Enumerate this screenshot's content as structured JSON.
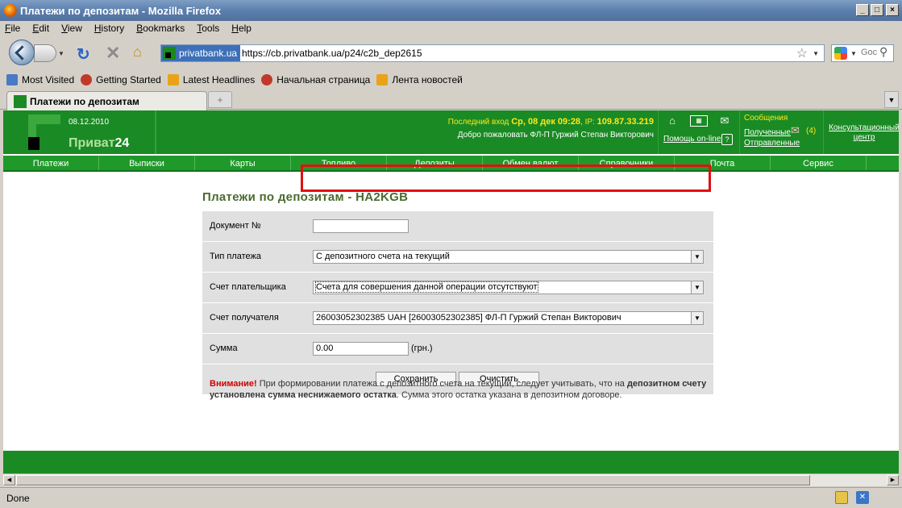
{
  "window": {
    "title": "Платежи по депозитам - Mozilla Firefox"
  },
  "menu": [
    "File",
    "Edit",
    "View",
    "History",
    "Bookmarks",
    "Tools",
    "Help"
  ],
  "address": {
    "site_label": "privatbank.ua",
    "url": "https://cb.privatbank.ua/p24/c2b_dep2615",
    "search_text": "Goc"
  },
  "bookmarks": [
    {
      "label": "Most Visited",
      "icon": "most-visited-icon",
      "color": "#4a7ac4"
    },
    {
      "label": "Getting Started",
      "icon": "firefox-icon",
      "color": "#c0392b"
    },
    {
      "label": "Latest Headlines",
      "icon": "rss-icon",
      "color": "#e8a317"
    },
    {
      "label": "Начальная страница",
      "icon": "firefox-icon",
      "color": "#c0392b"
    },
    {
      "label": "Лента новостей",
      "icon": "rss-icon",
      "color": "#e8a317"
    }
  ],
  "tab": {
    "title": "Платежи по депозитам"
  },
  "header": {
    "date": "08.12.2010",
    "brand_a": "Приват",
    "brand_b": "24",
    "last_login_label": "Последний вход",
    "last_login_value": "Ср, 08 дек 09:28",
    "ip_label": ", IP:",
    "ip_value": "109.87.33.219",
    "welcome": "Добро пожаловать ФЛ-П Гуржий Степан Викторович",
    "help": "Помощь on-line",
    "messages": "Сообщения",
    "received": "Полученные",
    "received_count": "(4)",
    "sent": "Отправленные",
    "consult_1": "Консультационный",
    "consult_2": "центр"
  },
  "nav": [
    "Платежи",
    "Выписки",
    "Карты",
    "Топливо",
    "Депозиты",
    "Обмен валют",
    "Справочники",
    "Почта",
    "Сервис"
  ],
  "form": {
    "title": "Платежи по депозитам - HA2KGB",
    "doc_label": "Документ №",
    "doc_value": "",
    "type_label": "Тип платежа",
    "type_value": "С депозитного счета на текущий",
    "payer_label": "Счет плательщика",
    "payer_value": "Счета для совершения данной операции отсутствуют",
    "recipient_label": "Счет получателя",
    "recipient_value": "26003052302385 UAH [26003052302385] ФЛ-П Гуржий Степан Викторович",
    "amount_label": "Сумма",
    "amount_value": "0.00",
    "currency": "(грн.)",
    "save": "Сохранить",
    "clear": "Очистить"
  },
  "warning": {
    "attention": "Внимание!",
    "text1": " При формировании платежа с депозитного счета на текущий, следует учитывать, что на ",
    "bold": "депозитном счету установлена сумма неснижаемого остатка",
    "text2": ". Сумма этого остатка указана в депозитном договоре."
  },
  "status": {
    "text": "Done"
  }
}
